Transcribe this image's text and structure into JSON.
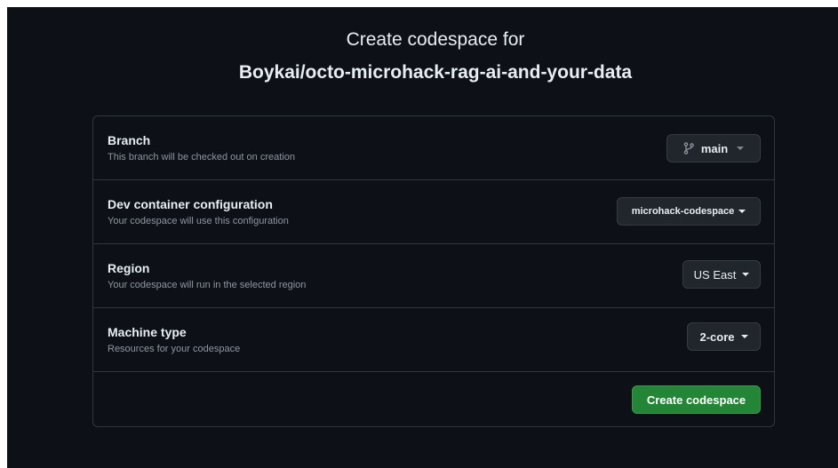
{
  "header": {
    "title_line1": "Create codespace for",
    "repo_name": "Boykai/octo-microhack-rag-ai-and-your-data"
  },
  "branch": {
    "title": "Branch",
    "description": "This branch will be checked out on creation",
    "value": "main",
    "icon": "git-branch-icon"
  },
  "dev_container": {
    "title": "Dev container configuration",
    "description": "Your codespace will use this configuration",
    "value": "microhack-codespace"
  },
  "region": {
    "title": "Region",
    "description": "Your codespace will run in the selected region",
    "value": "US East"
  },
  "machine_type": {
    "title": "Machine type",
    "description": "Resources for your codespace",
    "value": "2-core"
  },
  "actions": {
    "create_label": "Create codespace"
  },
  "colors": {
    "background": "#0d1117",
    "border": "#30363d",
    "button_bg": "#21262d",
    "primary_button": "#238636",
    "text": "#e6edf3",
    "muted_text": "#8d96a0"
  }
}
